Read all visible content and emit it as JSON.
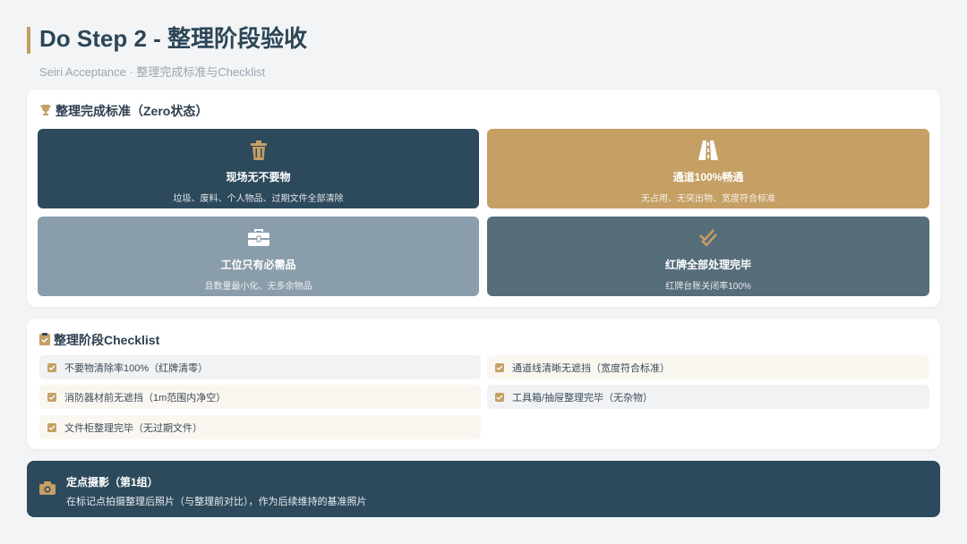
{
  "header": {
    "title": "Do Step 2 - 整理阶段验收",
    "subtitle": "Seiri Acceptance · 整理完成标准与Checklist"
  },
  "standards": {
    "title": "整理完成标准（Zero状态）",
    "icon": "trophy-icon",
    "tiles": [
      {
        "icon": "trash-icon",
        "name": "现场无不要物",
        "desc": "垃圾、废料、个人物品、过期文件全部清除",
        "color": "#2c4a5c"
      },
      {
        "icon": "road-icon",
        "name": "通道100%畅通",
        "desc": "无占用、无突出物、宽度符合标准",
        "color": "#c59f64"
      },
      {
        "icon": "toolbox-icon",
        "name": "工位只有必需品",
        "desc": "且数量最小化、无多余物品",
        "color": "#8a9daa"
      },
      {
        "icon": "double-check-icon",
        "name": "红牌全部处理完毕",
        "desc": "红牌台账关闭率100%",
        "color": "#566d7a"
      }
    ]
  },
  "checklist": {
    "title": "整理阶段Checklist",
    "icon": "clipboard-check-icon",
    "items": [
      "不要物清除率100%（红牌清零）",
      "通道线清晰无遮挡（宽度符合标准）",
      "消防器材前无遮挡（1m范围内净空）",
      "工具箱/抽屉整理完毕（无杂物）",
      "文件柜整理完毕（无过期文件）"
    ]
  },
  "banner": {
    "icon": "camera-icon",
    "title": "定点摄影（第1组）",
    "desc": "在标记点拍摄整理后照片（与整理前对比），作为后续维持的基准照片"
  },
  "colors": {
    "accent": "#c59f64",
    "dark": "#2c4a5c"
  }
}
